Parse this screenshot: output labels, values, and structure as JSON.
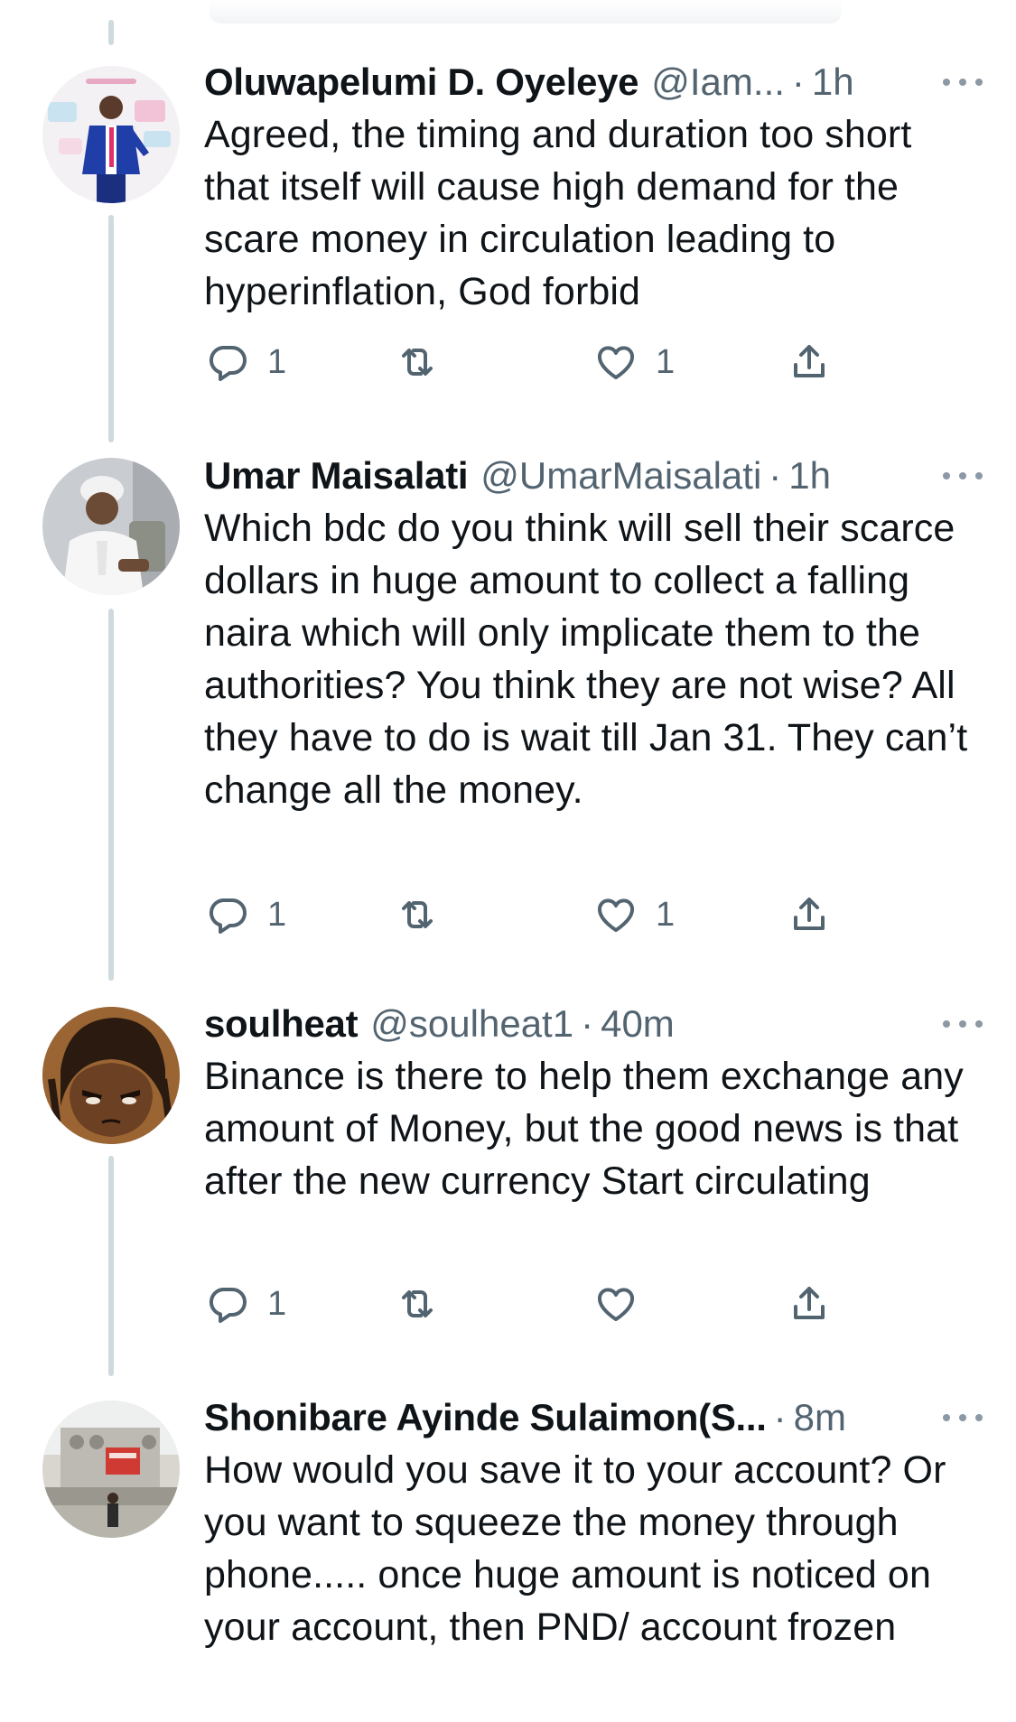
{
  "tweets": [
    {
      "name": "Oluwapelumi D. Oyeleye",
      "handle": "@Iam...",
      "time": "1h",
      "text": "Agreed, the timing and duration too short that itself will cause high demand for the scare money in circulation leading to hyperinflation, God forbid",
      "replies": "1",
      "retweets": "",
      "likes": "1"
    },
    {
      "name": "Umar Maisalati",
      "handle": "@UmarMaisalati",
      "time": "1h",
      "text": "Which bdc do you think will sell their scarce dollars in huge amount to collect a falling naira which will only implicate them to the authorities? You think they are not wise? All they have to do is wait till Jan 31. They can’t change all the money.",
      "replies": "1",
      "retweets": "",
      "likes": "1"
    },
    {
      "name": "soulheat",
      "handle": "@soulheat1",
      "time": "40m",
      "text": "Binance is there to help them exchange any amount of Money, but the good news is that after the new currency Start circulating",
      "replies": "1",
      "retweets": "",
      "likes": ""
    },
    {
      "name": "Shonibare Ayinde Sulaimon(S...",
      "handle": "",
      "time": "8m",
      "text": "How would you save it to your account? Or you want to squeeze the money through phone..... once huge amount is noticed on your account, then PND/ account frozen",
      "replies": "",
      "retweets": "",
      "likes": ""
    }
  ],
  "icons": {
    "reply": "reply-icon",
    "retweet": "retweet-icon",
    "like": "heart-icon",
    "share": "share-icon",
    "more": "more-icon"
  },
  "colors": {
    "text": "#0f1419",
    "secondary": "#536471",
    "thread_line": "#cfd9de"
  }
}
